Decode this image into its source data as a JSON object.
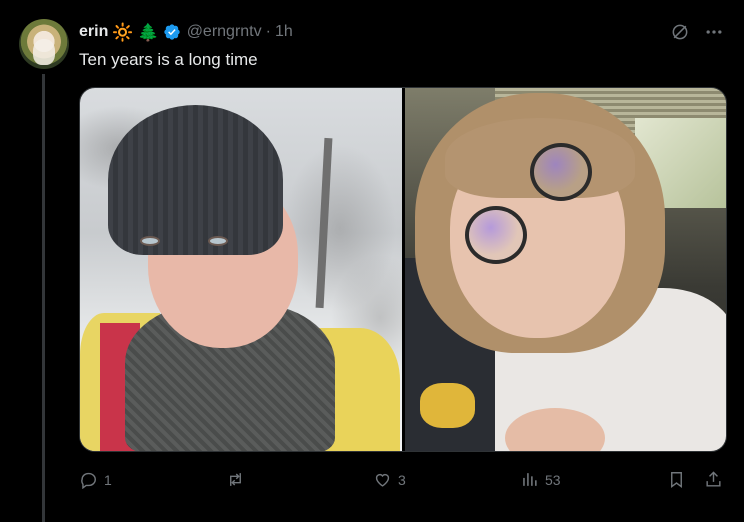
{
  "author": {
    "name": "erin",
    "emojis": [
      "🔆",
      "🌲"
    ],
    "handle": "@erngrntv",
    "separator": "·",
    "time": "1h"
  },
  "tweet": {
    "text": "Ten years is a long time"
  },
  "metrics": {
    "replies": "1",
    "retweets": "",
    "likes": "3",
    "views": "53"
  },
  "icons": {
    "grok": "grok-icon",
    "more": "more-icon",
    "reply": "reply-icon",
    "retweet": "retweet-icon",
    "like": "like-icon",
    "views": "views-icon",
    "bookmark": "bookmark-icon",
    "share": "share-icon"
  },
  "colors": {
    "background": "#000000",
    "text": "#e7e9ea",
    "muted": "#71767b",
    "verified": "#1d9bf0",
    "thread": "#333639"
  }
}
